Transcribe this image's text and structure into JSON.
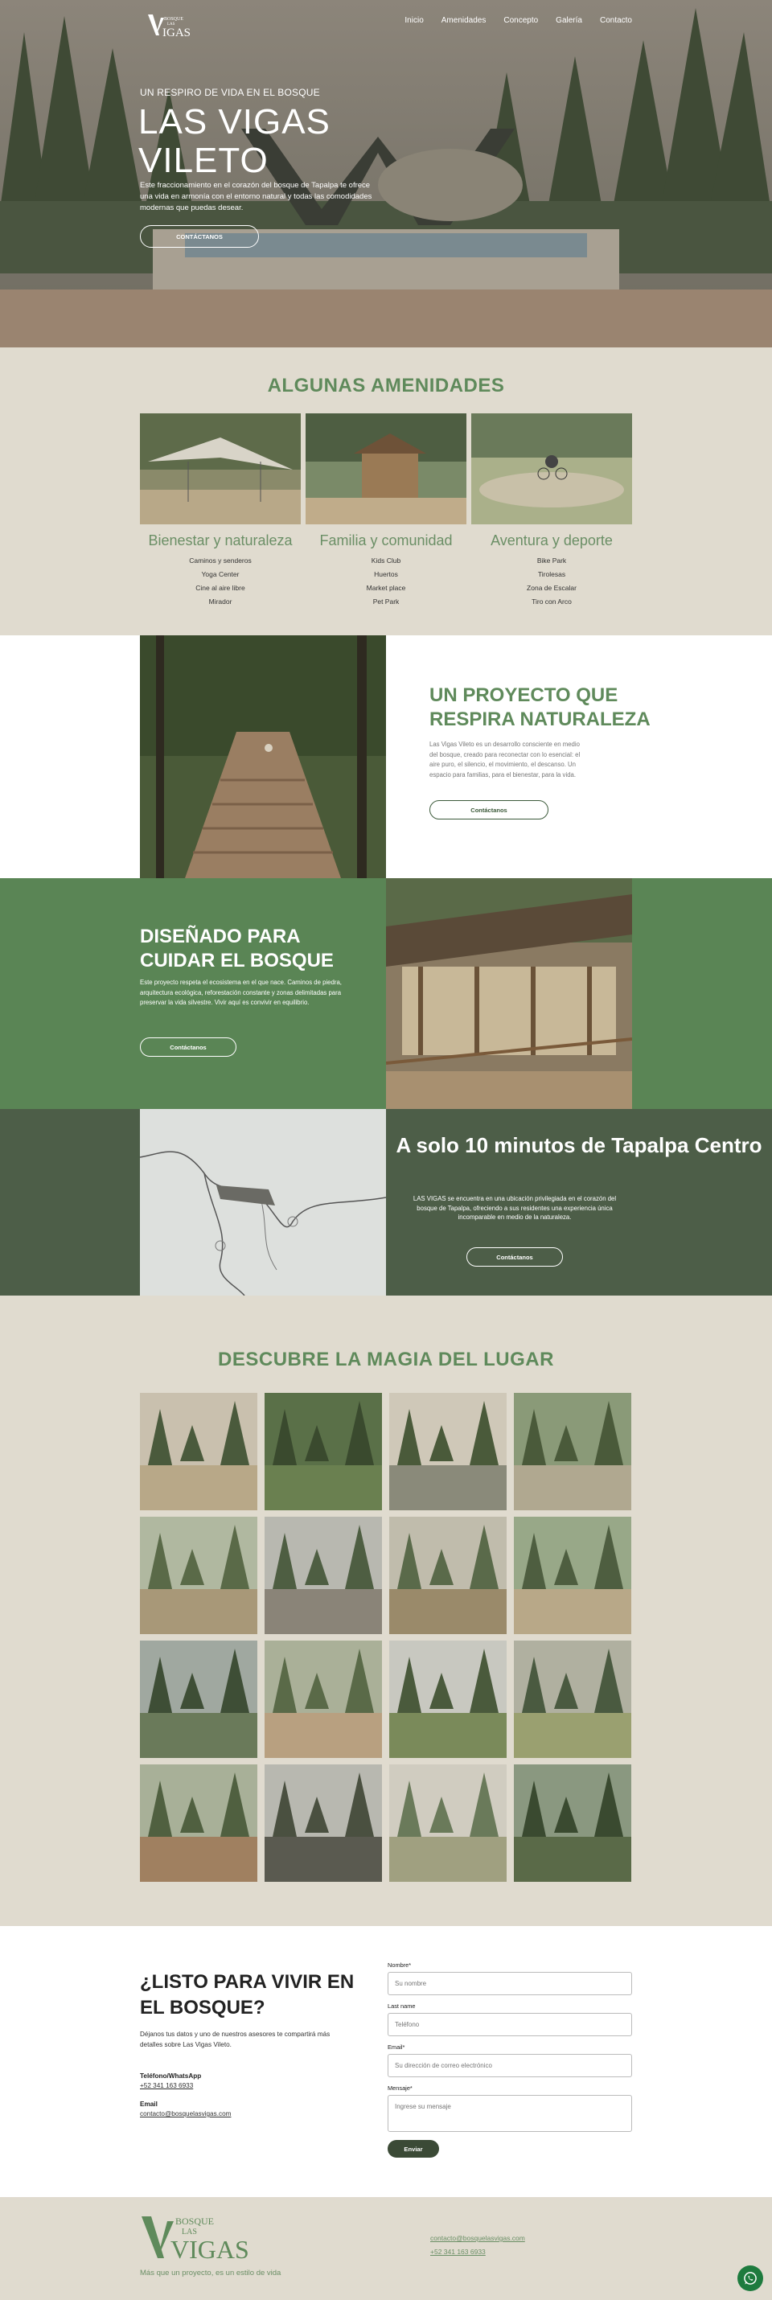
{
  "nav": {
    "links": [
      "Inicio",
      "Amenidades",
      "Concepto",
      "Galería",
      "Contacto"
    ],
    "logo_text": [
      "BOSQUE",
      "LAS",
      "VIGAS"
    ]
  },
  "hero": {
    "kicker": "UN RESPIRO DE VIDA EN EL BOSQUE",
    "title_line1": "LAS VIGAS",
    "title_line2": "VILETO",
    "description": "Este fraccionamiento en el corazón del bosque de Tapalpa te ofrece una vida en armonía con el entorno natural y todas las comodidades modernas que puedas desear.",
    "button": "CONTÁCTANOS"
  },
  "amenidades": {
    "title": "ALGUNAS AMENIDADES",
    "columns": [
      {
        "title": "Bienestar y naturaleza",
        "items": [
          "Caminos y senderos",
          "Yoga Center",
          "Cine al aire libre",
          "Mirador"
        ]
      },
      {
        "title": "Familia y comunidad",
        "items": [
          "Kids Club",
          "Huertos",
          "Market place",
          "Pet Park"
        ]
      },
      {
        "title": "Aventura y deporte",
        "items": [
          "Bike Park",
          "Tirolesas",
          "Zona de Escalar",
          "Tiro con Arco"
        ]
      }
    ]
  },
  "proyecto": {
    "title": "UN PROYECTO QUE RESPIRA NATURALEZA",
    "description": "Las Vigas Vileto es un desarrollo consciente en medio del bosque, creado para reconectar con lo esencial: el aire puro, el silencio, el movimiento, el descanso. Un espacio para familias, para el bienestar, para la vida.",
    "button": "Contáctanos"
  },
  "disenado": {
    "title": "DISEÑADO PARA CUIDAR EL BOSQUE",
    "description": "Este proyecto respeta el ecosistema en el que nace. Caminos de piedra, arquitectura ecológica, reforestación constante y zonas delimitadas para preservar la vida silvestre. Vivir aquí es convivir en equilibrio.",
    "button": "Contáctanos"
  },
  "mapa": {
    "title": "A solo 10 minutos de Tapalpa Centro",
    "description": "LAS VIGAS se encuentra en una ubicación privilegiada en el corazón del bosque de Tapalpa, ofreciendo a sus residentes una experiencia única incomparable en medio de la naturaleza.",
    "button": "Contáctanos"
  },
  "galeria": {
    "title": "DESCUBRE LA MAGIA DEL LUGAR",
    "image_count": 16
  },
  "contacto": {
    "title": "¿LISTO PARA VIVIR EN EL BOSQUE?",
    "description": "Déjanos tus datos y uno de nuestros asesores te compartirá más detalles sobre Las Vigas Vileto.",
    "phone_label": "Teléfono/WhatsApp",
    "phone": "+52 341 163 6933",
    "email_label": "Email",
    "email": "contacto@bosquelasvigas.com",
    "form": {
      "name_label": "Nombre*",
      "name_placeholder": "Su nombre",
      "last_label": "Last name",
      "last_placeholder": "Teléfono",
      "email_label": "Email*",
      "email_placeholder": "Su dirección de correo electrónico",
      "message_label": "Mensaje*",
      "message_placeholder": "Ingrese su mensaje",
      "submit": "Enviar"
    }
  },
  "footer": {
    "tagline": "Más que un proyecto, es un estilo de vida",
    "email": "contacto@bosquelasvigas.com",
    "phone": "+52 341 163 6933"
  },
  "colors": {
    "green": "#5f8a5b",
    "dark_green": "#4d5e48",
    "beige": "#e0dbcf",
    "whatsapp": "#1e7b3e"
  }
}
